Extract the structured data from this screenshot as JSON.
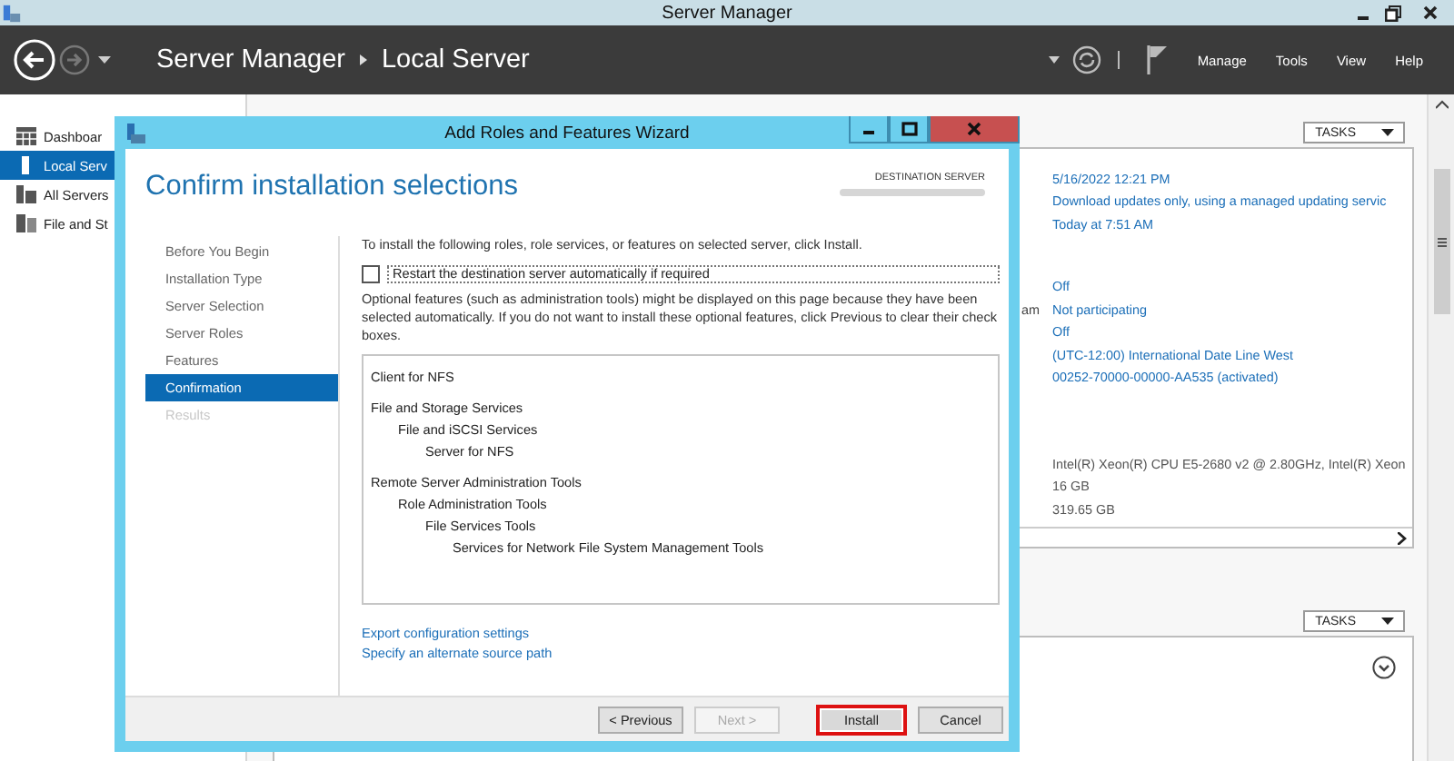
{
  "window": {
    "title": "Server Manager"
  },
  "header": {
    "breadcrumb": [
      "Server Manager",
      "Local Server"
    ],
    "menu": [
      "Manage",
      "Tools",
      "View",
      "Help"
    ]
  },
  "sidebar": {
    "items": [
      {
        "label": "Dashboar",
        "selected": false
      },
      {
        "label": "Local Serv",
        "selected": true
      },
      {
        "label": "All Servers",
        "selected": false
      },
      {
        "label": "File and St",
        "selected": false
      }
    ]
  },
  "properties": {
    "tasks_label": "TASKS",
    "groups": [
      [
        {
          "value": "5/16/2022 12:21 PM",
          "kind": "link"
        },
        {
          "value": "Download updates only, using a managed updating servic",
          "kind": "link"
        },
        {
          "value": "Today at 7:51 AM",
          "kind": "link"
        }
      ],
      [
        {
          "value": "Off",
          "kind": "link"
        },
        {
          "label": "am",
          "value": "Not participating",
          "kind": "link"
        },
        {
          "value": "Off",
          "kind": "link"
        },
        {
          "value": "(UTC-12:00) International Date Line West",
          "kind": "link"
        },
        {
          "value": "00252-70000-00000-AA535 (activated)",
          "kind": "link"
        }
      ],
      [
        {
          "value": "Intel(R) Xeon(R) CPU E5-2680 v2 @ 2.80GHz, Intel(R) Xeon",
          "kind": "plain"
        },
        {
          "value": "16 GB",
          "kind": "plain"
        },
        {
          "value": "319.65 GB",
          "kind": "plain"
        }
      ]
    ]
  },
  "second_panel": {
    "tasks_label": "TASKS"
  },
  "wizard": {
    "title": "Add Roles and Features Wizard",
    "heading": "Confirm installation selections",
    "destination_label": "DESTINATION SERVER",
    "steps": [
      {
        "label": "Before You Begin",
        "selected": false,
        "disabled": false
      },
      {
        "label": "Installation Type",
        "selected": false,
        "disabled": false
      },
      {
        "label": "Server Selection",
        "selected": false,
        "disabled": false
      },
      {
        "label": "Server Roles",
        "selected": false,
        "disabled": false
      },
      {
        "label": "Features",
        "selected": false,
        "disabled": false
      },
      {
        "label": "Confirmation",
        "selected": true,
        "disabled": false
      },
      {
        "label": "Results",
        "selected": false,
        "disabled": true
      }
    ],
    "intro": "To install the following roles, role services, or features on selected server, click Install.",
    "restart_checkbox": {
      "label": "Restart the destination server automatically if required",
      "checked": false
    },
    "note": "Optional features (such as administration tools) might be displayed on this page because they have been selected automatically. If you do not want to install these optional features, click Previous to clear their check boxes.",
    "features": [
      {
        "label": "Client for NFS"
      },
      {
        "label": "File and Storage Services",
        "children": [
          {
            "label": "File and iSCSI Services",
            "children": [
              {
                "label": "Server for NFS"
              }
            ]
          }
        ]
      },
      {
        "label": "Remote Server Administration Tools",
        "children": [
          {
            "label": "Role Administration Tools",
            "children": [
              {
                "label": "File Services Tools",
                "children": [
                  {
                    "label": "Services for Network File System Management Tools"
                  }
                ]
              }
            ]
          }
        ]
      }
    ],
    "links": [
      "Export configuration settings",
      "Specify an alternate source path"
    ],
    "buttons": [
      {
        "label": "< Previous",
        "disabled": false,
        "highlighted": false
      },
      {
        "label": "Next >",
        "disabled": true,
        "highlighted": false
      },
      {
        "label": "Install",
        "disabled": false,
        "highlighted": true
      },
      {
        "label": "Cancel",
        "disabled": false,
        "highlighted": false
      }
    ]
  }
}
